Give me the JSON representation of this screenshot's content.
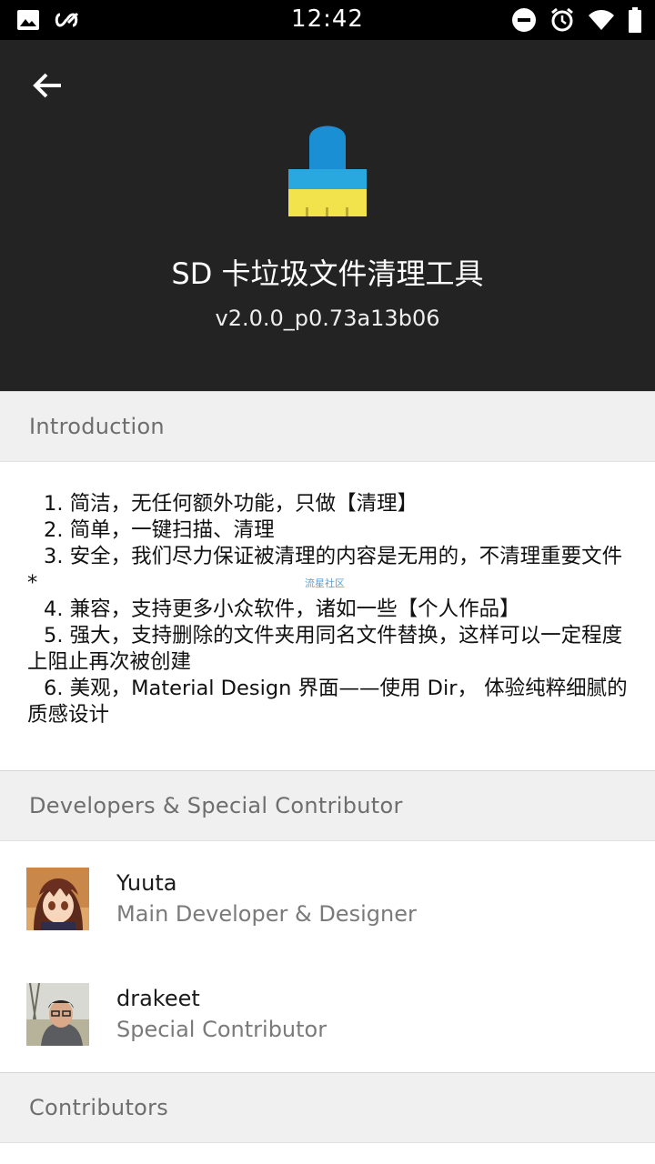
{
  "status_bar": {
    "time": "12:42",
    "left_icons": [
      "image-icon",
      "infinity-link-icon"
    ],
    "right_icons": [
      "do-not-disturb-icon",
      "alarm-icon",
      "wifi-icon",
      "battery-icon"
    ]
  },
  "header": {
    "app_name": "SD 卡垃圾文件清理工具",
    "version": "v2.0.0_p0.73a13b06",
    "background_color": "#232323",
    "icon_colors": {
      "handle": "#1a8fd4",
      "band": "#29a8e0",
      "bristles": "#f2e24c"
    }
  },
  "sections": {
    "introduction": "Introduction",
    "developers": "Developers & Special Contributor",
    "contributors": "Contributors"
  },
  "introduction": {
    "lines": [
      "1. 简洁，无任何额外功能，只做【清理】",
      "2. 简单，一键扫描、清理",
      "3. 安全，我们尽力保证被清理的内容是无用的，不清理重要文件 *",
      "4. 兼容，支持更多小众软件，诸如一些【个人作品】",
      "5. 强大，支持删除的文件夹用同名文件替换，这样可以一定程度上阻止再次被创建",
      "6. 美观，Material Design 界面——使用 Dir， 体验纯粹细腻的质感设计"
    ],
    "watermark": "流星社区"
  },
  "developers": [
    {
      "name": "Yuuta",
      "role": "Main Developer & Designer"
    },
    {
      "name": "drakeet",
      "role": "Special Contributor"
    }
  ]
}
